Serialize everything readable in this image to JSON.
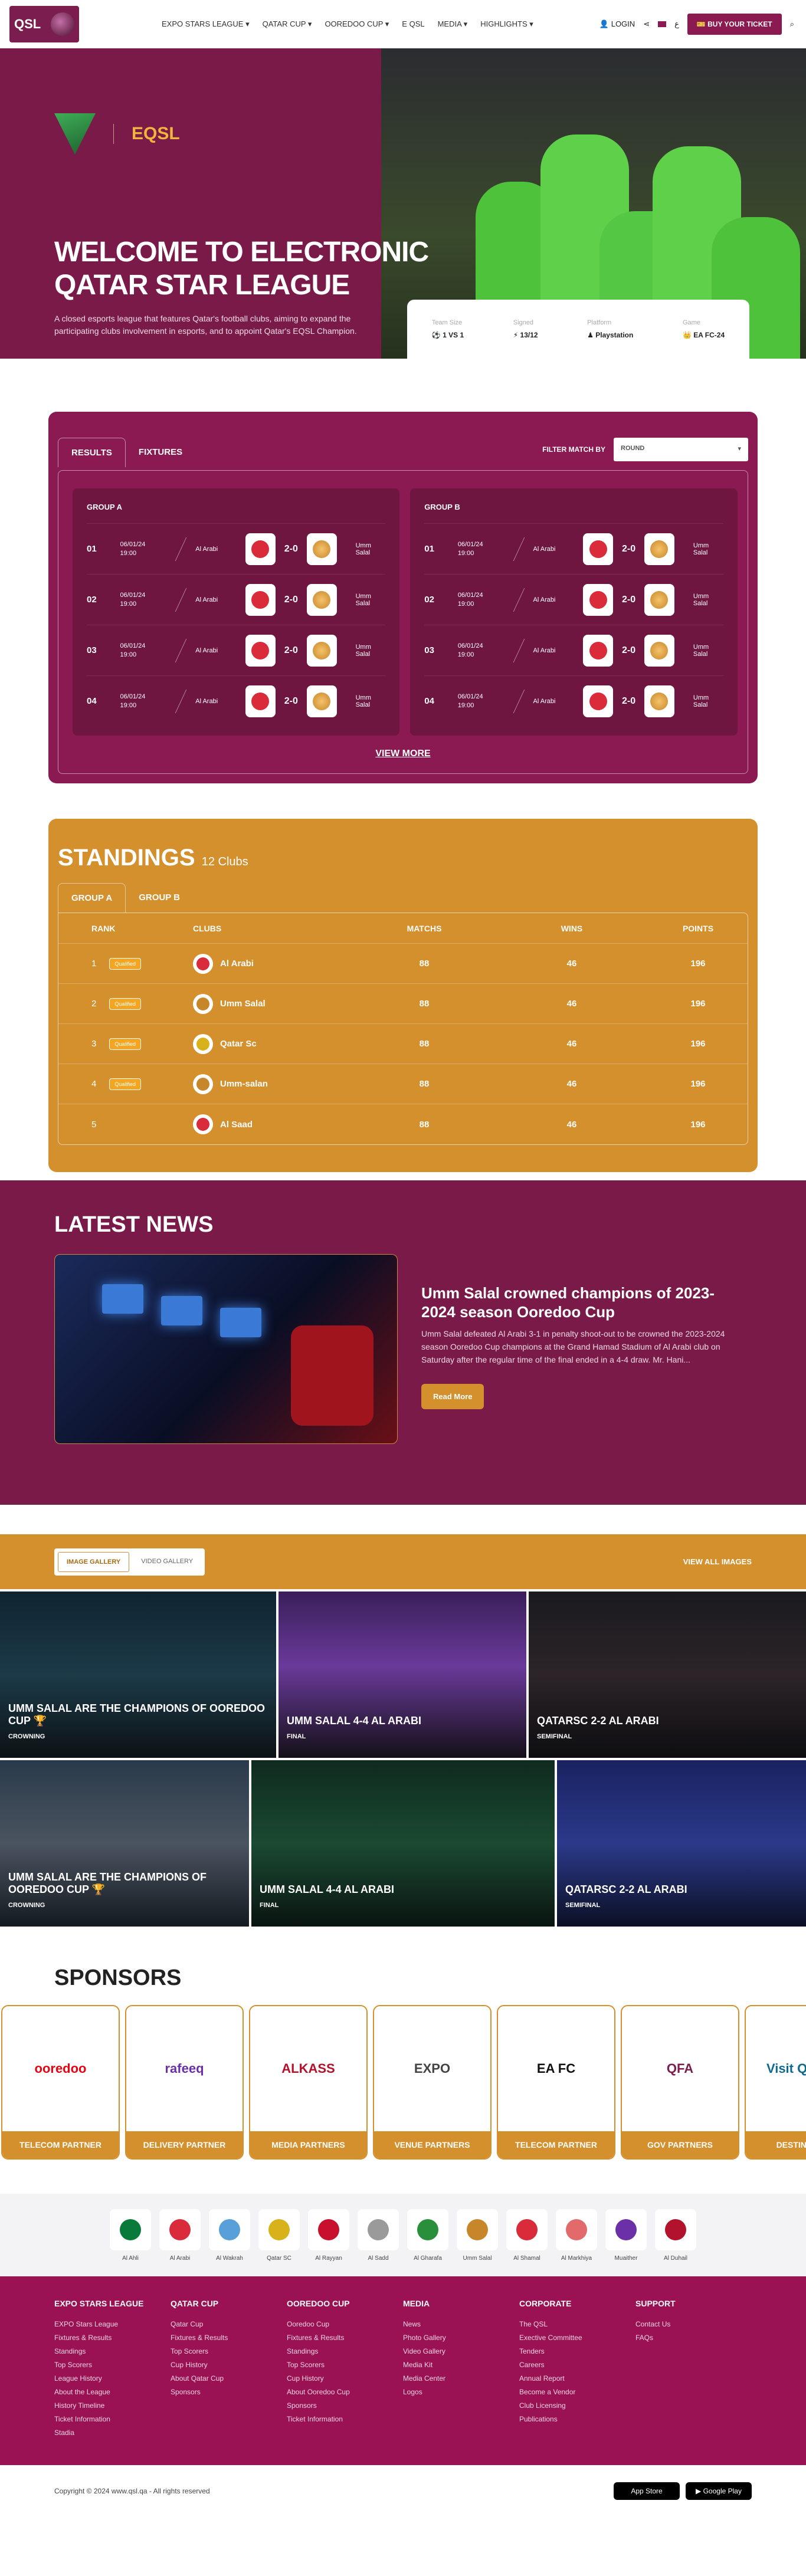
{
  "header": {
    "logo_text": "QSL",
    "nav": [
      "EXPO STARS LEAGUE",
      "QATAR CUP",
      "OOREDOO CUP",
      "E QSL",
      "MEDIA",
      "HIGHLIGHTS"
    ],
    "login": "LOGIN",
    "lang": "ع",
    "ticket": "BUY YOUR TICKET"
  },
  "hero": {
    "brand": "EQSL",
    "title_line1": "WELCOME TO ELECTRONIC",
    "title_line2": "QATAR STAR LEAGUE",
    "description": "A closed esports league that features Qatar's football clubs, aiming to expand the participating clubs involvement in esports, and to appoint Qatar's EQSL Champion.",
    "info": [
      {
        "label": "Team Size",
        "value": "1 VS 1"
      },
      {
        "label": "Signed",
        "value": "13/12"
      },
      {
        "label": "Platform",
        "value": "Playstation"
      },
      {
        "label": "Game",
        "value": "EA FC-24"
      }
    ]
  },
  "results": {
    "tabs": [
      "RESULTS",
      "FIXTURES"
    ],
    "filter_label": "FILTER MATCH BY",
    "filter_value": "ROUND",
    "groups": [
      {
        "name": "GROUP A",
        "matches": [
          {
            "num": "01",
            "date": "06/01/24",
            "time": "19:00",
            "home": "Al Arabi",
            "score": "2-0",
            "away": "Umm Salal"
          },
          {
            "num": "02",
            "date": "06/01/24",
            "time": "19:00",
            "home": "Al Arabi",
            "score": "2-0",
            "away": "Umm Salal"
          },
          {
            "num": "03",
            "date": "06/01/24",
            "time": "19:00",
            "home": "Al Arabi",
            "score": "2-0",
            "away": "Umm Salal"
          },
          {
            "num": "04",
            "date": "06/01/24",
            "time": "19:00",
            "home": "Al Arabi",
            "score": "2-0",
            "away": "Umm Salal"
          }
        ]
      },
      {
        "name": "GROUP B",
        "matches": [
          {
            "num": "01",
            "date": "06/01/24",
            "time": "19:00",
            "home": "Al Arabi",
            "score": "2-0",
            "away": "Umm Salal"
          },
          {
            "num": "02",
            "date": "06/01/24",
            "time": "19:00",
            "home": "Al Arabi",
            "score": "2-0",
            "away": "Umm Salal"
          },
          {
            "num": "03",
            "date": "06/01/24",
            "time": "19:00",
            "home": "Al Arabi",
            "score": "2-0",
            "away": "Umm Salal"
          },
          {
            "num": "04",
            "date": "06/01/24",
            "time": "19:00",
            "home": "Al Arabi",
            "score": "2-0",
            "away": "Umm Salal"
          }
        ]
      }
    ],
    "view_more": "VIEW MORE"
  },
  "standings": {
    "title": "STANDINGS",
    "count": "12 Clubs",
    "tabs": [
      "GROUP A",
      "GROUP B"
    ],
    "headers": [
      "RANK",
      "CLUBS",
      "MATCHS",
      "WINS",
      "POINTS"
    ],
    "rows": [
      {
        "rank": "1",
        "badge": "Qualified",
        "club": "Al Arabi",
        "matchs": "88",
        "wins": "46",
        "points": "196",
        "color": "#d92b3a"
      },
      {
        "rank": "2",
        "badge": "Qualified",
        "club": "Umm Salal",
        "matchs": "88",
        "wins": "46",
        "points": "196",
        "color": "#c8862b"
      },
      {
        "rank": "3",
        "badge": "Qualified",
        "club": "Qatar Sc",
        "matchs": "88",
        "wins": "46",
        "points": "196",
        "color": "#d8b21a"
      },
      {
        "rank": "4",
        "badge": "Qualified",
        "club": "Umm-salan",
        "matchs": "88",
        "wins": "46",
        "points": "196",
        "color": "#c8862b"
      },
      {
        "rank": "5",
        "badge": "",
        "club": "Al Saad",
        "matchs": "88",
        "wins": "46",
        "points": "196",
        "color": "#d92b3a"
      }
    ]
  },
  "news": {
    "title": "LATEST NEWS",
    "headline": "Umm Salal crowned champions of 2023-2024 season Ooredoo Cup",
    "body": "Umm Salal defeated Al Arabi 3-1 in penalty shoot-out to be crowned the 2023-2024 season Ooredoo Cup champions at the Grand Hamad Stadium of Al Arabi club on Saturday after the regular time of the final ended in a 4-4 draw. Mr. Hani...",
    "read_more": "Read More"
  },
  "gallery": {
    "tabs": [
      "IMAGE GALLERY",
      "VIDEO GALLERY"
    ],
    "view_all": "VIEW ALL IMAGES",
    "row1": [
      {
        "title": "UMM SALAL ARE THE CHAMPIONS OF OOREDOO CUP",
        "sub": "CROWNING",
        "trophy": "🏆"
      },
      {
        "title": "UMM SALAL 4-4 AL ARABI",
        "sub": "FINAL",
        "trophy": ""
      },
      {
        "title": "QATARSC 2-2 AL ARABI",
        "sub": "SEMIFINAL",
        "trophy": ""
      }
    ],
    "row2": [
      {
        "title": "UMM SALAL ARE THE CHAMPIONS OF OOREDOO CUP",
        "sub": "CROWNING",
        "trophy": "🏆"
      },
      {
        "title": "UMM SALAL 4-4 AL ARABI",
        "sub": "FINAL",
        "trophy": ""
      },
      {
        "title": "QATARSC 2-2 AL ARABI",
        "sub": "SEMIFINAL",
        "trophy": ""
      }
    ]
  },
  "sponsors": {
    "title": "SPONSORS",
    "items": [
      {
        "logo": "ooredoo",
        "label": "TELECOM PARTNER",
        "color": "#e30613"
      },
      {
        "logo": "rafeeq",
        "label": "DELIVERY PARTNER",
        "color": "#6b2fa8"
      },
      {
        "logo": "ALKASS",
        "label": "MEDIA PARTNERS",
        "color": "#b3122c"
      },
      {
        "logo": "EXPO",
        "label": "VENUE PARTNERS",
        "color": "#444444"
      },
      {
        "logo": "EA FC",
        "label": "TELECOM PARTNER",
        "color": "#111111"
      },
      {
        "logo": "QFA",
        "label": "GOV PARTNERS",
        "color": "#7b1d4f"
      },
      {
        "logo": "Visit QATAR",
        "label": "DESTINATION",
        "color": "#0f6a8f"
      }
    ]
  },
  "clubs": [
    {
      "name": "Al Ahli",
      "color": "#0a7a3a"
    },
    {
      "name": "Al Arabi",
      "color": "#d92b3a"
    },
    {
      "name": "Al Wakrah",
      "color": "#5aa0d8"
    },
    {
      "name": "Qatar SC",
      "color": "#d8b21a"
    },
    {
      "name": "Al Rayyan",
      "color": "#c8102e"
    },
    {
      "name": "Al Sadd",
      "color": "#9a9a9a"
    },
    {
      "name": "Al Gharafa",
      "color": "#2a8f3a"
    },
    {
      "name": "Umm Salal",
      "color": "#c8862b"
    },
    {
      "name": "Al Shamal",
      "color": "#d92b3a"
    },
    {
      "name": "Al Markhiya",
      "color": "#e26a6a"
    },
    {
      "name": "Muaither",
      "color": "#6b2fa8"
    },
    {
      "name": "Al Duhail",
      "color": "#b3122c"
    }
  ],
  "footer": {
    "columns": [
      {
        "title": "EXPO STARS LEAGUE",
        "links": [
          "EXPO Stars League",
          "Fixtures & Results",
          "Standings",
          "Top Scorers",
          "League History",
          "About the League",
          "History Timeline",
          "Ticket Information",
          "Stadia"
        ]
      },
      {
        "title": "QATAR CUP",
        "links": [
          "Qatar Cup",
          "Fixtures & Results",
          "Top Scorers",
          "Cup History",
          "About Qatar Cup",
          "Sponsors"
        ]
      },
      {
        "title": "OOREDOO CUP",
        "links": [
          "Ooredoo Cup",
          "Fixtures & Results",
          "Standings",
          "Top Scorers",
          "Cup History",
          "About Ooredoo Cup",
          "Sponsors",
          "Ticket Information"
        ]
      },
      {
        "title": "MEDIA",
        "links": [
          "News",
          "Photo Gallery",
          "Video Gallery",
          "Media Kit",
          "Media Center",
          "Logos"
        ]
      },
      {
        "title": "CORPORATE",
        "links": [
          "The QSL",
          "Exective Committee",
          "Tenders",
          "Careers",
          "Annual Report",
          "Become a Vendor",
          "Club Licensing",
          "Publications"
        ]
      },
      {
        "title": "SUPPORT",
        "links": [
          "Contact Us",
          "FAQs"
        ]
      }
    ],
    "copyright": "Copyright © 2024 www.qsl.qa - All rights reserved",
    "app_store": "App Store",
    "google_play": "Google Play"
  }
}
